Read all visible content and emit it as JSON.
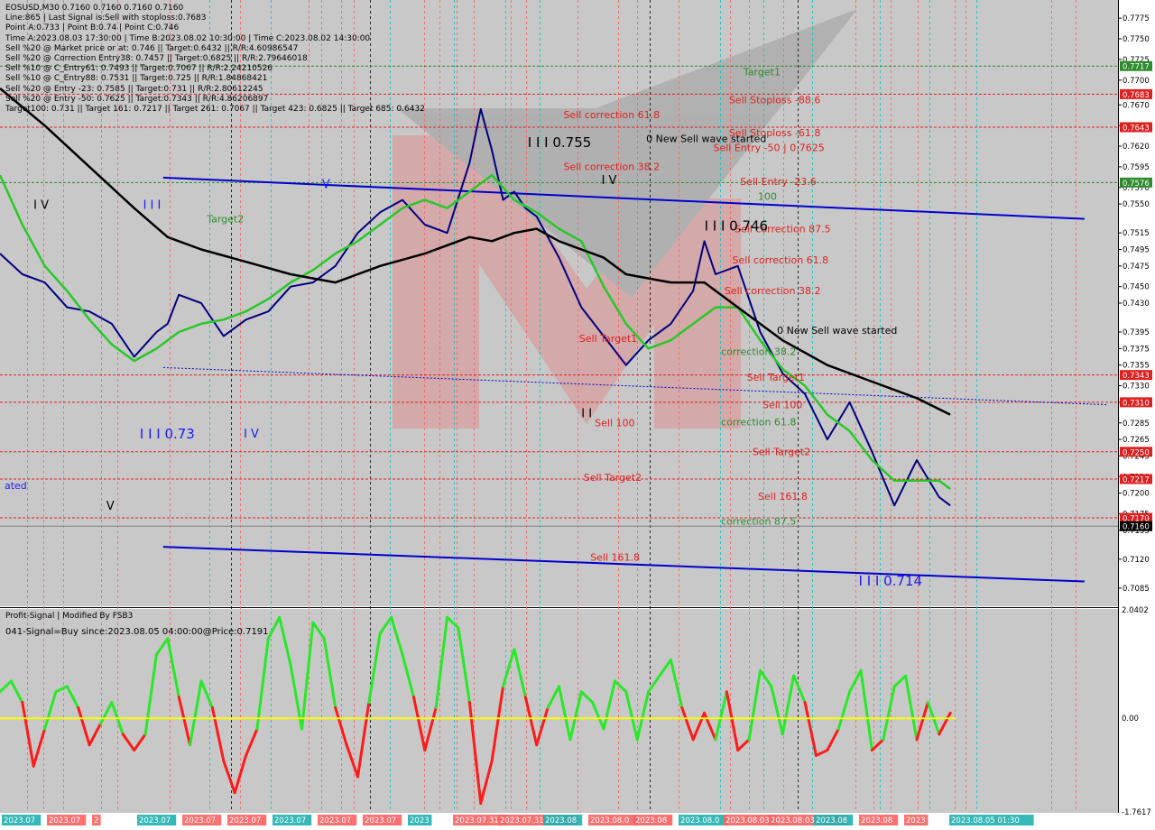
{
  "header": {
    "lines": [
      "EOSUSD,M30  0.7160 0.7160 0.7160 0.7160",
      "Line:865 | Last Signal is:Sell with stoploss:0.7683",
      "Point A:0.733 | Point B:0.74 | Point C:0.746",
      "Time A:2023.08.03 17:30:00 | Time B:2023.08.02 10:30:00 | Time C:2023.08.02 14:30:00",
      "Sell %20 @ Market price or at: 0.746 || Target:0.6432 || R/R:4.60986547",
      "Sell %20 @ Correction Entry38: 0.7457 || Target:0.6825 || R/R:2.79646018",
      "Sell %10 @ C_Entry61: 0.7493 || Target:0.7067 || R/R:2.24210526",
      "Sell %10 @ C_Entry88: 0.7531 || Target:0.725 || R/R:1.84868421",
      "Sell %20 @ Entry -23: 0.7585 || Target:0.731 || R/R:2.80612245",
      "Sell %20 @ Entry -50: 0.7625 || Target:0.7343 || R/R:4.86206897",
      "Target100: 0.731 || Target 161: 0.7217 || Target 261: 0.7067 || Target 423: 0.6825 || Target 685: 0.6432"
    ]
  },
  "chart_data": [
    {
      "type": "line",
      "symbol": "EOSUSD,M30",
      "ylim": [
        0.7063,
        0.7797
      ],
      "price_axis_ticks": [
        "0.7775",
        "0.7750",
        "0.7725",
        "0.7700",
        "0.7670",
        "0.7645",
        "0.7620",
        "0.7595",
        "0.7570",
        "0.7550",
        "0.7515",
        "0.7495",
        "0.7475",
        "0.7450",
        "0.7430",
        "0.7395",
        "0.7375",
        "0.7355",
        "0.7330",
        "0.7310",
        "0.7285",
        "0.7265",
        "0.7245",
        "0.7220",
        "0.7200",
        "0.7175",
        "0.7155",
        "0.7120",
        "0.7085"
      ],
      "price_labels": [
        {
          "text": "0.7717",
          "value": 0.7717,
          "color": "#2e8b2e"
        },
        {
          "text": "0.7683",
          "value": 0.7683,
          "color": "#e02020"
        },
        {
          "text": "0.7643",
          "value": 0.7643,
          "color": "#e02020"
        },
        {
          "text": "0.7576",
          "value": 0.7576,
          "color": "#2e8b2e"
        },
        {
          "text": "0.7343",
          "value": 0.7343,
          "color": "#e02020"
        },
        {
          "text": "0.7310",
          "value": 0.731,
          "color": "#e02020"
        },
        {
          "text": "0.7250",
          "value": 0.725,
          "color": "#e02020"
        },
        {
          "text": "0.7217",
          "value": 0.7217,
          "color": "#e02020"
        },
        {
          "text": "0.7170",
          "value": 0.717,
          "color": "#e02020"
        },
        {
          "text": "0.7160",
          "value": 0.716,
          "color": "#000000"
        }
      ],
      "levels": [
        {
          "value": 0.7717,
          "color": "#2e8b2e"
        },
        {
          "value": 0.7683,
          "color": "#e02020"
        },
        {
          "value": 0.7643,
          "color": "#e02020"
        },
        {
          "value": 0.7576,
          "color": "#2e8b2e"
        },
        {
          "value": 0.7343,
          "color": "#e02020"
        },
        {
          "value": 0.731,
          "color": "#e02020"
        },
        {
          "value": 0.725,
          "color": "#e02020"
        },
        {
          "value": 0.7217,
          "color": "#e02020"
        },
        {
          "value": 0.717,
          "color": "#e02020"
        }
      ],
      "annotations": [
        {
          "text": "Target1",
          "x": 0.665,
          "y": 0.7706,
          "color": "#2e8b2e"
        },
        {
          "text": "Sell Stoploss -88.6",
          "x": 0.652,
          "y": 0.7672,
          "color": "#e02020"
        },
        {
          "text": "Sell Stoploss -61.8",
          "x": 0.652,
          "y": 0.7632,
          "color": "#e02020"
        },
        {
          "text": "Sell Entry -50 | 0.7625",
          "x": 0.638,
          "y": 0.7614,
          "color": "#e02020"
        },
        {
          "text": "Sell Entry -23.6",
          "x": 0.662,
          "y": 0.7573,
          "color": "#e02020"
        },
        {
          "text": "Sell correction 61.8",
          "x": 0.504,
          "y": 0.7654,
          "color": "#e02020"
        },
        {
          "text": "Sell correction 38.2",
          "x": 0.504,
          "y": 0.7591,
          "color": "#e02020"
        },
        {
          "text": "Sell correction 87.5",
          "x": 0.657,
          "y": 0.7516,
          "color": "#e02020"
        },
        {
          "text": "Sell correction 61.8",
          "x": 0.655,
          "y": 0.7478,
          "color": "#e02020"
        },
        {
          "text": "Sell correction 38.2",
          "x": 0.648,
          "y": 0.7441,
          "color": "#e02020"
        },
        {
          "text": "0 New Sell wave started",
          "x": 0.578,
          "y": 0.7625,
          "color": "#000000"
        },
        {
          "text": "0 New Sell wave started",
          "x": 0.695,
          "y": 0.7393,
          "color": "#000000"
        },
        {
          "text": "I I I 0.755",
          "x": 0.472,
          "y": 0.7619,
          "color": "#000000",
          "size": 15
        },
        {
          "text": "I I I 0.746",
          "x": 0.63,
          "y": 0.7518,
          "color": "#000000",
          "size": 15
        },
        {
          "text": "I I I 0.73",
          "x": 0.125,
          "y": 0.7266,
          "color": "#1a1aff",
          "size": 15
        },
        {
          "text": "I I I 0.714",
          "x": 0.768,
          "y": 0.7088,
          "color": "#1a1aff",
          "size": 15
        },
        {
          "text": "Sell Target1",
          "x": 0.518,
          "y": 0.7383,
          "color": "#e02020"
        },
        {
          "text": "Sell Target1",
          "x": 0.668,
          "y": 0.7336,
          "color": "#e02020"
        },
        {
          "text": "Sell 100",
          "x": 0.532,
          "y": 0.7281,
          "color": "#e02020"
        },
        {
          "text": "Sell 100",
          "x": 0.682,
          "y": 0.7303,
          "color": "#e02020"
        },
        {
          "text": "Sell Target2",
          "x": 0.522,
          "y": 0.7215,
          "color": "#e02020"
        },
        {
          "text": "Sell Target2",
          "x": 0.673,
          "y": 0.7246,
          "color": "#e02020"
        },
        {
          "text": "Sell 161.8",
          "x": 0.678,
          "y": 0.7192,
          "color": "#e02020"
        },
        {
          "text": "Sell 161.8",
          "x": 0.528,
          "y": 0.7118,
          "color": "#e02020"
        },
        {
          "text": "correction 38.2",
          "x": 0.645,
          "y": 0.7367,
          "color": "#2e8b2e"
        },
        {
          "text": "correction 61.8",
          "x": 0.645,
          "y": 0.7282,
          "color": "#2e8b2e"
        },
        {
          "text": "correction 87.5",
          "x": 0.645,
          "y": 0.7162,
          "color": "#2e8b2e"
        },
        {
          "text": "100",
          "x": 0.678,
          "y": 0.7555,
          "color": "#2e8b2e"
        },
        {
          "text": "Target2",
          "x": 0.185,
          "y": 0.7528,
          "color": "#2e8b2e"
        },
        {
          "text": "I V",
          "x": 0.03,
          "y": 0.7544,
          "color": "#000000",
          "size": 13
        },
        {
          "text": "I I I",
          "x": 0.128,
          "y": 0.7544,
          "color": "#1a1aff",
          "size": 13
        },
        {
          "text": "I V",
          "x": 0.538,
          "y": 0.7574,
          "color": "#000000",
          "size": 13
        },
        {
          "text": "I V",
          "x": 0.218,
          "y": 0.7267,
          "color": "#1a1aff",
          "size": 13
        },
        {
          "text": "V",
          "x": 0.095,
          "y": 0.718,
          "color": "#000000",
          "size": 13
        },
        {
          "text": "V",
          "x": 0.288,
          "y": 0.7569,
          "color": "#1a1aff",
          "size": 13
        },
        {
          "text": "I I",
          "x": 0.52,
          "y": 0.7292,
          "color": "#000000",
          "size": 13
        },
        {
          "text": "ated",
          "x": 0.004,
          "y": 0.7205,
          "color": "#1a1aff"
        }
      ],
      "series": [
        {
          "kind": "close-approx",
          "color": "#000080",
          "x": [
            0.0,
            0.02,
            0.04,
            0.06,
            0.08,
            0.1,
            0.12,
            0.14,
            0.15,
            0.16,
            0.18,
            0.2,
            0.22,
            0.24,
            0.26,
            0.28,
            0.3,
            0.32,
            0.34,
            0.36,
            0.38,
            0.4,
            0.42,
            0.43,
            0.44,
            0.45,
            0.46,
            0.47,
            0.48,
            0.5,
            0.52,
            0.54,
            0.56,
            0.58,
            0.6,
            0.62,
            0.63,
            0.64,
            0.66,
            0.68,
            0.7,
            0.72,
            0.74,
            0.76,
            0.78,
            0.8,
            0.82,
            0.84,
            0.85
          ],
          "y": [
            0.749,
            0.7465,
            0.7455,
            0.7425,
            0.742,
            0.7405,
            0.7365,
            0.7395,
            0.7405,
            0.744,
            0.743,
            0.739,
            0.741,
            0.742,
            0.745,
            0.7455,
            0.7475,
            0.7515,
            0.754,
            0.7555,
            0.7525,
            0.7515,
            0.76,
            0.7665,
            0.7615,
            0.7555,
            0.7565,
            0.7545,
            0.7535,
            0.7485,
            0.7425,
            0.739,
            0.7355,
            0.7385,
            0.7405,
            0.7445,
            0.7505,
            0.7465,
            0.7475,
            0.7395,
            0.7345,
            0.732,
            0.7265,
            0.731,
            0.725,
            0.7185,
            0.724,
            0.7195,
            0.7185
          ]
        },
        {
          "kind": "ma-fast",
          "color": "#28c828",
          "x": [
            0.0,
            0.02,
            0.04,
            0.06,
            0.08,
            0.1,
            0.12,
            0.14,
            0.16,
            0.18,
            0.2,
            0.22,
            0.24,
            0.26,
            0.28,
            0.3,
            0.32,
            0.34,
            0.36,
            0.38,
            0.4,
            0.42,
            0.44,
            0.46,
            0.48,
            0.5,
            0.52,
            0.54,
            0.56,
            0.58,
            0.6,
            0.62,
            0.64,
            0.66,
            0.68,
            0.7,
            0.72,
            0.74,
            0.76,
            0.78,
            0.8,
            0.82,
            0.84,
            0.85
          ],
          "y": [
            0.7585,
            0.7525,
            0.7475,
            0.7445,
            0.741,
            0.738,
            0.736,
            0.7375,
            0.7395,
            0.7405,
            0.741,
            0.742,
            0.7435,
            0.7455,
            0.747,
            0.749,
            0.7505,
            0.7525,
            0.7545,
            0.7555,
            0.7545,
            0.7565,
            0.7585,
            0.7555,
            0.754,
            0.752,
            0.7505,
            0.745,
            0.7405,
            0.7375,
            0.7385,
            0.7405,
            0.7425,
            0.7425,
            0.7385,
            0.735,
            0.733,
            0.7295,
            0.7275,
            0.724,
            0.7215,
            0.7215,
            0.7215,
            0.7205
          ]
        },
        {
          "kind": "ma-slow",
          "color": "#000000",
          "x": [
            0.0,
            0.04,
            0.08,
            0.12,
            0.15,
            0.18,
            0.22,
            0.26,
            0.3,
            0.34,
            0.38,
            0.42,
            0.44,
            0.46,
            0.48,
            0.5,
            0.52,
            0.54,
            0.56,
            0.6,
            0.63,
            0.66,
            0.7,
            0.74,
            0.78,
            0.82,
            0.85
          ],
          "y": [
            0.769,
            0.7645,
            0.7595,
            0.7545,
            0.751,
            0.7495,
            0.748,
            0.7465,
            0.7455,
            0.7475,
            0.749,
            0.751,
            0.7505,
            0.7515,
            0.752,
            0.7505,
            0.7495,
            0.7485,
            0.7465,
            0.7455,
            0.7455,
            0.7425,
            0.7385,
            0.7355,
            0.7335,
            0.7315,
            0.7295
          ]
        }
      ],
      "trend_lines": [
        {
          "x": [
            0.146,
            0.97
          ],
          "y": [
            0.7582,
            0.7532
          ],
          "color": "#0000cd"
        },
        {
          "x": [
            0.146,
            0.97
          ],
          "y": [
            0.7135,
            0.7093
          ],
          "color": "#0000cd"
        },
        {
          "x": [
            0.146,
            0.99
          ],
          "y": [
            0.7352,
            0.7307
          ],
          "color": "#0000cd",
          "dashed": true
        }
      ]
    },
    {
      "type": "line",
      "title": "Profit-Signal | Modified By FSB3",
      "subtitle": "041-Signal=Buy since:2023.08.05 04:00:00@Price:0.7191",
      "ylim": [
        -1.7617,
        2.0402
      ],
      "price_axis_ticks": [
        "2.0402",
        "0.00",
        "-1.7617"
      ],
      "oscillator": {
        "x": [
          0.0,
          0.01,
          0.02,
          0.03,
          0.04,
          0.05,
          0.06,
          0.07,
          0.08,
          0.09,
          0.1,
          0.11,
          0.12,
          0.13,
          0.14,
          0.15,
          0.16,
          0.17,
          0.18,
          0.19,
          0.2,
          0.21,
          0.22,
          0.23,
          0.24,
          0.25,
          0.26,
          0.27,
          0.28,
          0.29,
          0.3,
          0.31,
          0.32,
          0.33,
          0.34,
          0.35,
          0.36,
          0.37,
          0.38,
          0.39,
          0.4,
          0.41,
          0.42,
          0.43,
          0.44,
          0.45,
          0.46,
          0.47,
          0.48,
          0.49,
          0.5,
          0.51,
          0.52,
          0.53,
          0.54,
          0.55,
          0.56,
          0.57,
          0.58,
          0.59,
          0.6,
          0.61,
          0.62,
          0.63,
          0.64,
          0.65,
          0.66,
          0.67,
          0.68,
          0.69,
          0.7,
          0.71,
          0.72,
          0.73,
          0.74,
          0.75,
          0.76,
          0.77,
          0.78,
          0.79,
          0.8,
          0.81,
          0.82,
          0.83,
          0.84,
          0.85
        ],
        "y": [
          0.5,
          0.7,
          0.3,
          -0.9,
          -0.2,
          0.5,
          0.6,
          0.2,
          -0.5,
          -0.1,
          0.3,
          -0.3,
          -0.6,
          -0.3,
          1.2,
          1.5,
          0.4,
          -0.5,
          0.7,
          0.2,
          -0.8,
          -1.4,
          -0.7,
          -0.2,
          1.5,
          1.9,
          1.0,
          -0.2,
          1.8,
          1.5,
          0.2,
          -0.5,
          -1.1,
          0.3,
          1.6,
          1.9,
          1.2,
          0.4,
          -0.6,
          0.2,
          1.9,
          1.7,
          0.3,
          -1.6,
          -0.8,
          0.6,
          1.3,
          0.4,
          -0.5,
          0.2,
          0.6,
          -0.4,
          0.5,
          0.3,
          -0.2,
          0.7,
          0.5,
          -0.4,
          0.5,
          0.8,
          1.1,
          0.2,
          -0.4,
          0.1,
          -0.4,
          0.5,
          -0.6,
          -0.4,
          0.9,
          0.6,
          -0.3,
          0.8,
          0.3,
          -0.7,
          -0.6,
          -0.2,
          0.5,
          0.9,
          -0.6,
          -0.4,
          0.6,
          0.8,
          -0.4,
          0.3,
          -0.3,
          0.1
        ]
      },
      "zero_line_color": "#ffff00",
      "positive_color": "#28e828",
      "negative_color": "#ff1a1a"
    }
  ],
  "time_axis": {
    "labels": [
      "2023.07",
      "2023.07",
      "2",
      "2023.07",
      "2023.07",
      "2023.07",
      "2023.07",
      "2023.07",
      "2023.07",
      "2023",
      "2023.07.31",
      "2023.07.31 12:0",
      "2023.08",
      "2023.08.0",
      "2023.08",
      "2023.08.0",
      "2023.08.03",
      "2023.08.03 07:0",
      "2023.08",
      "2023.08",
      "2023",
      "2023.08.05 01:30"
    ]
  },
  "colors": {
    "background": "#c0c0c0",
    "axis_bg": "#ffffff",
    "grid_vertical_red": "#ff6060",
    "grid_vertical_cyan": "#00c8c8",
    "grid_vertical_black": "#000000"
  }
}
